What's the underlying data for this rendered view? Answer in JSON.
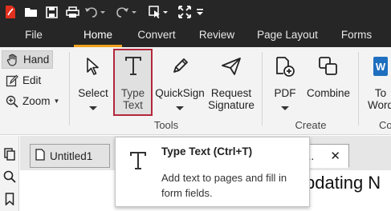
{
  "quick_access": {
    "icons": [
      "app-logo-icon",
      "open-folder-icon",
      "save-icon",
      "print-icon",
      "undo-icon",
      "redo-icon",
      "select-icon",
      "expand-icon",
      "customize-icon"
    ]
  },
  "menu": {
    "tabs": [
      {
        "label": "File"
      },
      {
        "label": "Home"
      },
      {
        "label": "Convert"
      },
      {
        "label": "Review"
      },
      {
        "label": "Page Layout"
      },
      {
        "label": "Forms"
      }
    ],
    "active": "Home"
  },
  "ribbon": {
    "hand_label": "Hand",
    "edit_label": "Edit",
    "zoom_label": "Zoom",
    "select_label": "Select",
    "type_text_label": "Type\nText",
    "quicksign_label": "QuickSign",
    "request_signature_label": "Request\nSignature",
    "tools_group": "Tools",
    "pdf_label": "PDF",
    "combine_label": "Combine",
    "create_group": "Create",
    "to_word_label": "To\nWord",
    "next_group_partial": "Co"
  },
  "doc_tabs": {
    "first": "Untitled1",
    "second_partial": "...",
    "close_symbol": "✕"
  },
  "document": {
    "visible_text": "pdating N"
  },
  "tooltip": {
    "title": "Type Text (Ctrl+T)",
    "description": "Add text to pages and fill in form fields."
  },
  "colors": {
    "title_bar": "#262626",
    "active_tab_underline": "#f0a21c",
    "highlight_border": "#b3263b",
    "ribbon_bg": "#f3f3f3",
    "word_blue": "#1e6fbf",
    "logo_red": "#e0301e"
  }
}
